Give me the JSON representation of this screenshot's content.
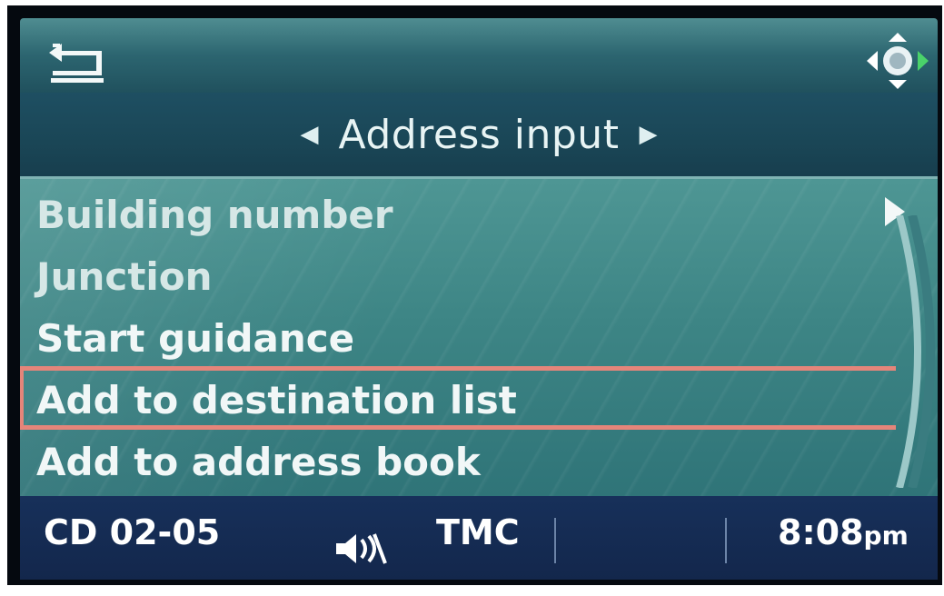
{
  "header": {
    "back_icon": "back-arrow-icon",
    "controller_icon": "joystick-navigation-icon",
    "title": "Address input",
    "title_left_arrow": "◀",
    "title_right_arrow": "▶"
  },
  "menu": {
    "items": [
      {
        "label": "Building number",
        "selected": false
      },
      {
        "label": "Junction",
        "selected": false
      },
      {
        "label": "Start guidance",
        "selected": false
      },
      {
        "label": "Add to destination list",
        "selected": true
      },
      {
        "label": "Add to address book",
        "selected": false
      }
    ],
    "highlight_color": "#e5857a"
  },
  "status": {
    "source": "CD 02-05",
    "audio_icon": "speaker-muted-icon",
    "tmc": "TMC",
    "time": "8:08",
    "ampm": "pm"
  }
}
